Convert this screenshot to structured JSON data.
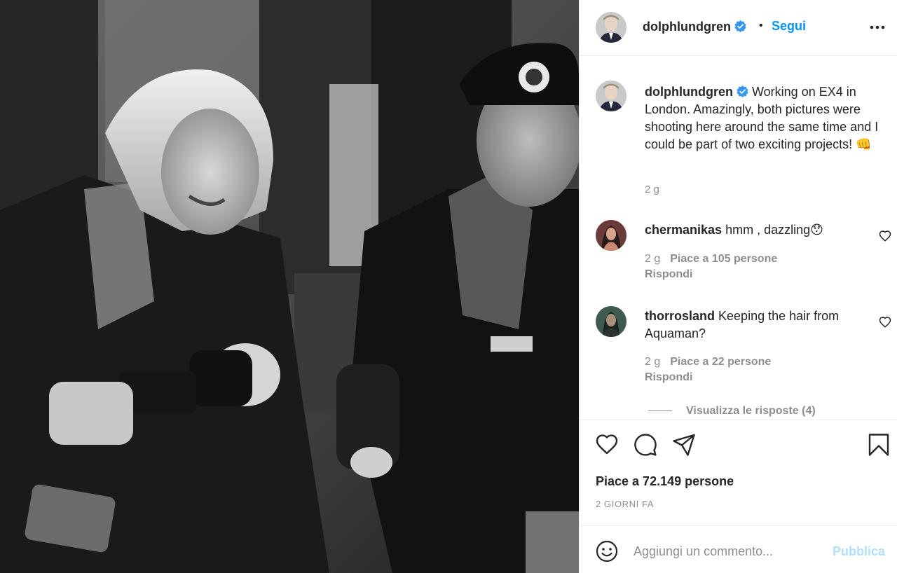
{
  "post": {
    "username": "dolphlundgren",
    "follow_label": "Segui",
    "verified_icon": "verified-badge-icon",
    "more_icon": "more-options-icon"
  },
  "caption": {
    "username": "dolphlundgren",
    "text": "Working on EX4 in London. Amazingly, both pictures were shooting here around the same time and I could be part of two exciting projects! 👊",
    "time": "2 g"
  },
  "comments": [
    {
      "username": "chermanikas",
      "text": "hmm , dazzling😯",
      "time": "2 g",
      "likes": "Piace a 105 persone",
      "reply_label": "Rispondi"
    },
    {
      "username": "thorrosland",
      "text": "Keeping the hair from Aquaman?",
      "time": "2 g",
      "likes": "Piace a 22 persone",
      "reply_label": "Rispondi",
      "view_replies": "Visualizza le risposte (4)"
    }
  ],
  "actions": {
    "icons": [
      "heart-icon",
      "comment-icon",
      "share-icon",
      "bookmark-icon"
    ],
    "likes_count": "Piace a 72.149 persone",
    "date": "2 GIORNI FA"
  },
  "add_comment": {
    "placeholder": "Aggiungi un commento...",
    "publish_label": "Pubblica",
    "emoji_icon": "emoji-icon"
  },
  "colors": {
    "accent_blue": "#0095f6",
    "publish_disabled": "#b2dffc",
    "secondary_text": "#8e8e8e",
    "primary_text": "#262626"
  }
}
